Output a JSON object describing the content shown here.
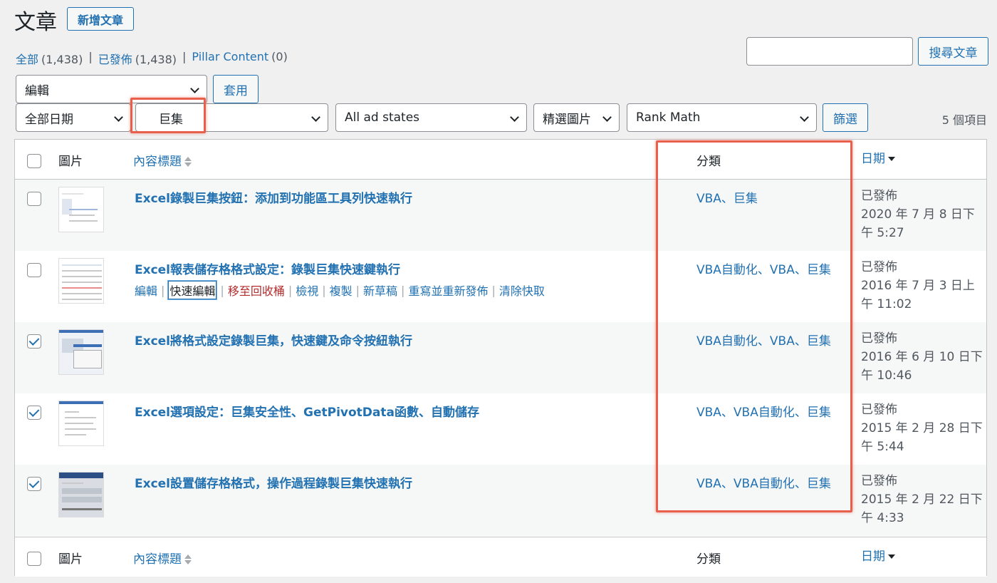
{
  "header": {
    "title": "文章",
    "add_new": "新增文章"
  },
  "views": [
    {
      "label": "全部",
      "count": "(1,438)"
    },
    {
      "label": "已發佈",
      "count": "(1,438)"
    },
    {
      "label": "Pillar Content",
      "count": "(0)"
    }
  ],
  "views_separator": "|",
  "search": {
    "value": "",
    "button": "搜尋文章"
  },
  "bulk": {
    "selected": "編輯",
    "apply": "套用"
  },
  "filters": {
    "dates": "全部日期",
    "category": "巨集",
    "ad_states": "All ad states",
    "featured": "精選圖片",
    "rank_math": "Rank Math",
    "filter_button": "篩選",
    "items_count": "5 個項目"
  },
  "columns": {
    "image": "圖片",
    "title": "內容標題",
    "categories": "分類",
    "date": "日期"
  },
  "posts": [
    {
      "checked": false,
      "title": "Excel錄製巨集按鈕：添加到功能區工具列快速執行",
      "categories": "VBA、巨集",
      "status": "已發佈",
      "date": "2020 年 7 月 8 日下午 5:27"
    },
    {
      "checked": false,
      "title": "Excel報表儲存格格式設定：錄製巨集快速鍵執行",
      "categories": "VBA自動化、VBA、巨集",
      "status": "已發佈",
      "date": "2016 年 7 月 3 日上午 11:02"
    },
    {
      "checked": true,
      "title": "Excel將格式設定錄製巨集，快速鍵及命令按紐執行",
      "categories": "VBA自動化、VBA、巨集",
      "status": "已發佈",
      "date": "2016 年 6 月 10 日下午 10:46"
    },
    {
      "checked": true,
      "title": "Excel選項設定：巨集安全性、GetPivotData函數、自動儲存",
      "categories": "VBA、VBA自動化、巨集",
      "status": "已發佈",
      "date": "2015 年 2 月 28 日下午 5:44"
    },
    {
      "checked": true,
      "title": "Excel設置儲存格格式，操作過程錄製巨集快速執行",
      "categories": "VBA、VBA自動化、巨集",
      "status": "已發佈",
      "date": "2015 年 2 月 22 日下午 4:33"
    }
  ],
  "row_actions": {
    "edit": "編輯",
    "quick_edit": "快速編輯",
    "trash": "移至回收桶",
    "view": "檢視",
    "duplicate": "複製",
    "new_draft": "新草稿",
    "rewrite": "重寫並重新發佈",
    "clear_cache": "清除快取",
    "separator": "|"
  },
  "colors": {
    "link": "#2271b1",
    "highlight": "#e8604c",
    "trash": "#b32d2e"
  }
}
